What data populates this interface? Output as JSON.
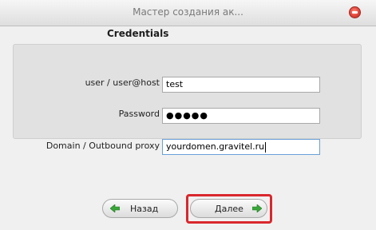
{
  "window": {
    "title": "Мастер создания ак...",
    "close_icon": "close-icon"
  },
  "form": {
    "heading": "Credentials",
    "user_label": "user / user@host",
    "user_value": "test",
    "password_label": "Password",
    "password_value": "●●●●●",
    "domain_label": "Domain / Outbound proxy",
    "domain_value": "yourdomen.gravitel.ru"
  },
  "buttons": {
    "back_label": "Назад",
    "back_icon": "arrow-left-icon",
    "next_label": "Далее",
    "next_icon": "arrow-right-icon"
  },
  "colors": {
    "highlight": "#d9272d",
    "arrow_green": "#3aa63a",
    "active_field_border": "#6aa0d8"
  }
}
